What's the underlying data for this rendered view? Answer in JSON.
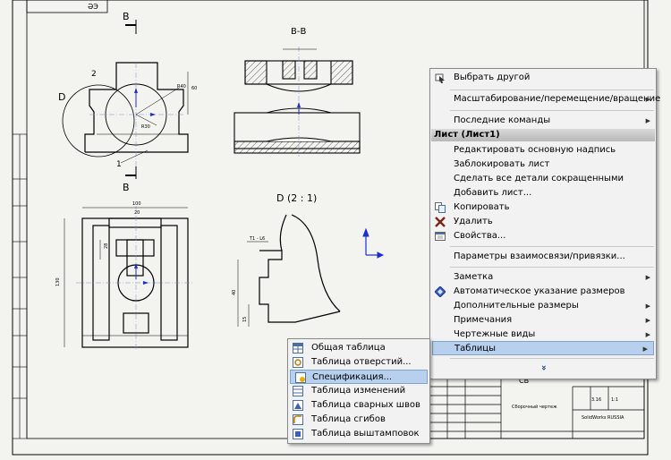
{
  "sheet": {
    "title_block_code": "ӘЭ",
    "view_labels": {
      "section_marker_top": "В",
      "section_marker_bottom": "В",
      "section_view": "В-В",
      "detail_view": "D  (2 : 1)",
      "detail_circle": "D",
      "balloon_1": "1",
      "balloon_2": "2",
      "detail_note": "T1 - L6"
    },
    "dims": {
      "d100": "100",
      "d130": "130",
      "d40": "40",
      "d28": "28",
      "d20": "20",
      "d60": "60",
      "d15": "15",
      "r40": "R40",
      "r30": "R30"
    },
    "title_block": {
      "drawing_name": "Сборочный чертеж",
      "company": "SolidWorks\nRUSSIA",
      "scale": "1:1",
      "mass": "3.16",
      "code": "СВ"
    }
  },
  "context_menu": {
    "items": [
      {
        "label": "Выбрать другой",
        "icon": "select-other-icon",
        "submenu": false
      },
      {
        "label": "Масштабирование/перемещение/вращение",
        "icon": "",
        "submenu": true
      },
      {
        "label": "Последние команды",
        "icon": "",
        "submenu": true
      },
      {
        "label": "Лист (Лист1)",
        "section": true
      },
      {
        "label": "Редактировать основную надпись",
        "icon": "",
        "submenu": false
      },
      {
        "label": "Заблокировать лист",
        "icon": "",
        "submenu": false
      },
      {
        "label": "Сделать все детали сокращенными",
        "icon": "",
        "submenu": false
      },
      {
        "label": "Добавить лист...",
        "icon": "",
        "submenu": false
      },
      {
        "label": "Копировать",
        "icon": "copy-icon",
        "submenu": false
      },
      {
        "label": "Удалить",
        "icon": "delete-icon",
        "submenu": false
      },
      {
        "label": "Свойства...",
        "icon": "properties-icon",
        "submenu": false
      },
      {
        "label": "Параметры взаимосвязи/привязки...",
        "icon": "",
        "submenu": false
      },
      {
        "label": "Заметка",
        "icon": "",
        "submenu": true
      },
      {
        "label": "Автоматическое указание размеров",
        "icon": "auto-dimension-icon",
        "submenu": false
      },
      {
        "label": "Дополнительные размеры",
        "icon": "",
        "submenu": true
      },
      {
        "label": "Примечания",
        "icon": "",
        "submenu": true
      },
      {
        "label": "Чертежные виды",
        "icon": "",
        "submenu": true
      },
      {
        "label": "Таблицы",
        "icon": "",
        "submenu": true,
        "highlighted": true
      },
      {
        "label": "»",
        "icon": "",
        "expand": true
      }
    ]
  },
  "submenu": {
    "items": [
      {
        "label": "Общая таблица",
        "icon": "general-table-icon"
      },
      {
        "label": "Таблица отверстий...",
        "icon": "hole-table-icon"
      },
      {
        "label": "Спецификация...",
        "icon": "bom-icon",
        "highlighted": true
      },
      {
        "label": "Таблица изменений",
        "icon": "revision-table-icon"
      },
      {
        "label": "Таблица сварных швов",
        "icon": "weld-table-icon"
      },
      {
        "label": "Таблица сгибов",
        "icon": "bend-table-icon"
      },
      {
        "label": "Таблица выштамповок",
        "icon": "punch-table-icon"
      }
    ]
  },
  "colors": {
    "highlight": "#b6d0ee",
    "drawing_line": "#000000",
    "axis_blue": "#1b2fd1"
  }
}
